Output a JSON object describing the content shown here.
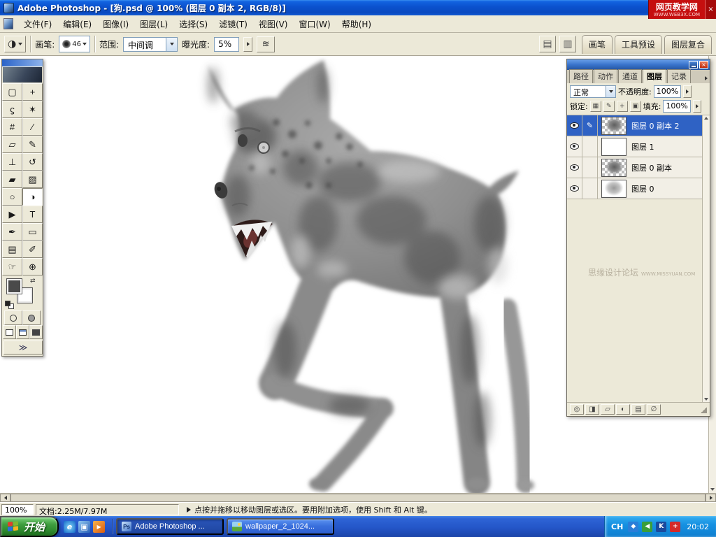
{
  "window": {
    "title": "Adobe Photoshop - [狗.psd @ 100% (图层 0 副本 2, RGB/8)]",
    "ad_badge": {
      "line1": "网页教学网",
      "line2": "WWW.WEB3X.COM",
      "close_glyph": "×"
    }
  },
  "menu_bar": {
    "items": [
      "文件(F)",
      "编辑(E)",
      "图像(I)",
      "图层(L)",
      "选择(S)",
      "滤镜(T)",
      "视图(V)",
      "窗口(W)",
      "帮助(H)"
    ]
  },
  "options_bar": {
    "tool_preset_glyph": "◑",
    "brush_label": "画笔:",
    "brush_size": "46",
    "range_label": "范围:",
    "range_value": "中间调",
    "exposure_label": "曝光度:",
    "exposure_value": "5%",
    "airbrush_glyph": "≋",
    "page_icon_glyph": "▤",
    "printer_icon_glyph": "▥",
    "palette_well_tabs": [
      "画笔",
      "工具预设",
      "图层复合"
    ]
  },
  "toolbox": {
    "swap_glyph": "⇄",
    "imageready_glyph": "≫",
    "tools": [
      {
        "name": "rectangular-marquee",
        "glyph": "▢"
      },
      {
        "name": "move",
        "glyph": "+"
      },
      {
        "name": "lasso",
        "glyph": "ϛ"
      },
      {
        "name": "magic-wand",
        "glyph": "✶"
      },
      {
        "name": "crop",
        "glyph": "#"
      },
      {
        "name": "slice",
        "glyph": "∕"
      },
      {
        "name": "healing-brush",
        "glyph": "▱"
      },
      {
        "name": "brush",
        "glyph": "✎"
      },
      {
        "name": "clone-stamp",
        "glyph": "⊥"
      },
      {
        "name": "history-brush",
        "glyph": "↺"
      },
      {
        "name": "eraser",
        "glyph": "▰"
      },
      {
        "name": "gradient",
        "glyph": "▨"
      },
      {
        "name": "blur",
        "glyph": "○"
      },
      {
        "name": "dodge",
        "glyph": "◑"
      },
      {
        "name": "path-selection",
        "glyph": "▶"
      },
      {
        "name": "type",
        "glyph": "T"
      },
      {
        "name": "pen",
        "glyph": "✒"
      },
      {
        "name": "shape",
        "glyph": "▭"
      },
      {
        "name": "notes",
        "glyph": "▤"
      },
      {
        "name": "eyedropper",
        "glyph": "✐"
      },
      {
        "name": "hand",
        "glyph": "☞"
      },
      {
        "name": "zoom",
        "glyph": "⊕"
      }
    ]
  },
  "layers_panel": {
    "tabs": [
      "路径",
      "动作",
      "通道",
      "图层",
      "记录"
    ],
    "blend_mode": "正常",
    "opacity_label": "不透明度:",
    "opacity_value": "100%",
    "lock_label": "锁定:",
    "lock_icons": [
      "▦",
      "✎",
      "+",
      "▣"
    ],
    "fill_label": "填充:",
    "fill_value": "100%",
    "close_glyph": "×",
    "layers": [
      {
        "name": "图层 0 副本 2",
        "paint_glyph": "✎"
      },
      {
        "name": "图层 1",
        "paint_glyph": ""
      },
      {
        "name": "图层 0 副本",
        "paint_glyph": ""
      },
      {
        "name": "图层 0",
        "paint_glyph": ""
      }
    ],
    "watermark_text": "思缘设计论坛",
    "watermark_url": "WWW.MISSYUAN.COM",
    "bottom_icons": [
      {
        "name": "layer-style",
        "glyph": "◎"
      },
      {
        "name": "layer-mask",
        "glyph": "◨"
      },
      {
        "name": "layer-set",
        "glyph": "▱"
      },
      {
        "name": "adjustment-layer",
        "glyph": "◐"
      },
      {
        "name": "new-layer",
        "glyph": "▤"
      },
      {
        "name": "delete-layer",
        "glyph": "∅"
      }
    ]
  },
  "status_bar": {
    "zoom": "100%",
    "doc_size": "文档:2.25M/7.97M",
    "hint": "点按并拖移以移动图层或选区。要用附加选项，使用 Shift 和 Alt 键。"
  },
  "taskbar": {
    "start_label": "开始",
    "quicklaunch": [
      {
        "name": "internet-explorer",
        "glyph": "e"
      },
      {
        "name": "show-desktop",
        "glyph": "▣"
      },
      {
        "name": "media-player",
        "glyph": "▶"
      }
    ],
    "tasks": [
      {
        "label": "Adobe Photoshop ...",
        "icon_text": "Ps"
      },
      {
        "label": "wallpaper_2_1024...",
        "icon_text": ""
      }
    ],
    "language_indicator": "CH",
    "tray_icons": [
      {
        "name": "network",
        "glyph": "◆"
      },
      {
        "name": "volume",
        "glyph": "◀"
      },
      {
        "name": "antivirus",
        "glyph": "K"
      },
      {
        "name": "security",
        "glyph": "+"
      }
    ],
    "clock": "20:02"
  },
  "colors": {
    "titlebar_blue": "#0b51cd",
    "selection_blue": "#2f62c4",
    "taskbar_blue": "#2456c8",
    "start_green": "#3f9e3f",
    "badge_red": "#c50f0f",
    "palette_bg": "#ece9d8"
  }
}
